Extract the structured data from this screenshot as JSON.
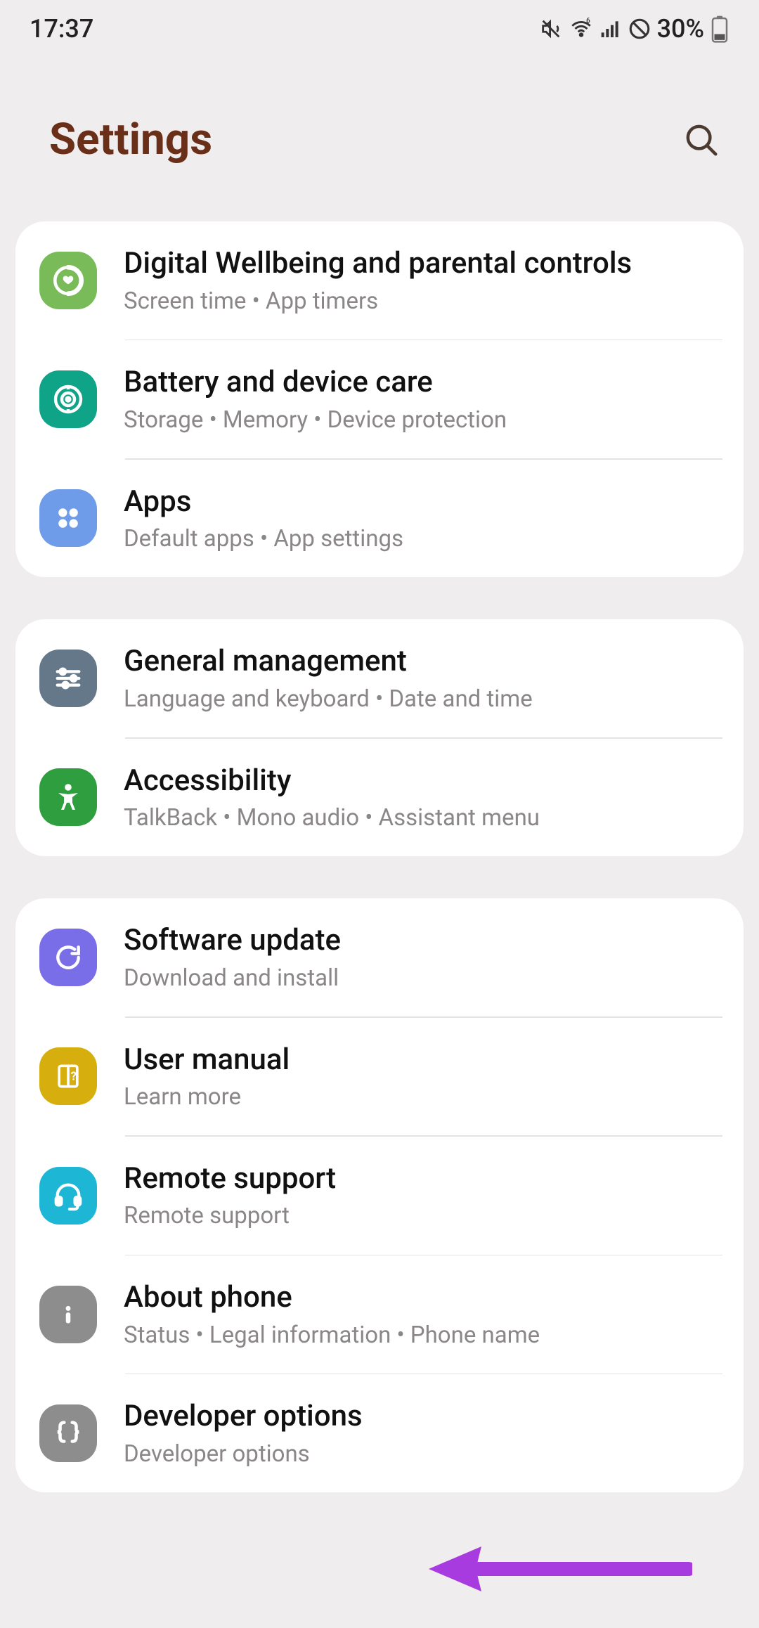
{
  "status": {
    "time": "17:37",
    "battery_pct": "30%"
  },
  "header": {
    "title": "Settings"
  },
  "groups": [
    {
      "items": [
        {
          "icon": "wellbeing",
          "color": "#78bb58",
          "title": "Digital Wellbeing and parental controls",
          "sub": "Screen time  •  App timers"
        },
        {
          "icon": "battery-care",
          "color": "#0fa388",
          "title": "Battery and device care",
          "sub": "Storage  •  Memory  •  Device protection"
        },
        {
          "icon": "apps",
          "color": "#6e9ce8",
          "title": "Apps",
          "sub": "Default apps  •  App settings"
        }
      ]
    },
    {
      "items": [
        {
          "icon": "sliders",
          "color": "#64788a",
          "title": "General management",
          "sub": "Language and keyboard  •  Date and time"
        },
        {
          "icon": "accessibility",
          "color": "#2f9e3f",
          "title": "Accessibility",
          "sub": "TalkBack  •  Mono audio  •  Assistant menu"
        }
      ]
    },
    {
      "items": [
        {
          "icon": "update",
          "color": "#7a6ee8",
          "title": "Software update",
          "sub": "Download and install"
        },
        {
          "icon": "manual",
          "color": "#d6ae0e",
          "title": "User manual",
          "sub": "Learn more"
        },
        {
          "icon": "headset",
          "color": "#1db6d4",
          "title": "Remote support",
          "sub": "Remote support"
        },
        {
          "icon": "info",
          "color": "#8d8d8d",
          "title": "About phone",
          "sub": "Status  •  Legal information  •  Phone name"
        },
        {
          "icon": "braces",
          "color": "#8d8d8d",
          "title": "Developer options",
          "sub": "Developer options"
        }
      ]
    }
  ]
}
